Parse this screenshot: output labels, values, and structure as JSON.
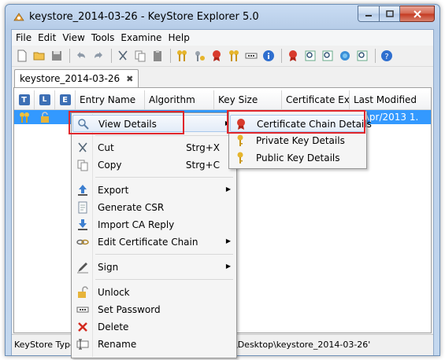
{
  "window": {
    "title": "keystore_2014-03-26 - KeyStore Explorer 5.0"
  },
  "menubar": [
    "File",
    "Edit",
    "View",
    "Tools",
    "Examine",
    "Help"
  ],
  "toolbar": {
    "icons": [
      "new-icon",
      "open-icon",
      "save-icon",
      "undo-icon",
      "redo-icon",
      "cut-icon",
      "copy-icon",
      "paste-icon",
      "generate-keypair-icon",
      "generate-secret-key-icon",
      "import-trusted-cert-icon",
      "import-keypair-icon",
      "set-password-icon",
      "properties-icon",
      "examine-file-icon",
      "examine-clipboard-icon",
      "examine-ssl-icon",
      "examine-csr-icon",
      "examine-crl-icon",
      "help-icon"
    ]
  },
  "tab": {
    "label": "keystore_2014-03-26",
    "close": "✖"
  },
  "table": {
    "icon_headers": [
      "T",
      "L",
      "E"
    ],
    "headers": [
      "Entry Name",
      "Algorithm",
      "Key Size",
      "Certificate Ex...",
      "Last Modified"
    ],
    "row": {
      "last_modified": "5/Apr/2013 1..."
    }
  },
  "status": {
    "left": "KeyStore Type",
    "right": "\\Desktop\\keystore_2014-03-26'"
  },
  "context_menu": {
    "view_details": "View Details",
    "cut": "Cut",
    "cut_shortcut": "Strg+X",
    "copy": "Copy",
    "copy_shortcut": "Strg+C",
    "export": "Export",
    "generate_csr": "Generate CSR",
    "import_ca_reply": "Import CA Reply",
    "edit_cert_chain": "Edit Certificate Chain",
    "sign": "Sign",
    "unlock": "Unlock",
    "set_password": "Set Password",
    "delete": "Delete",
    "rename": "Rename"
  },
  "submenu": {
    "cert_chain_details": "Certificate Chain Details",
    "private_key_details": "Private Key Details",
    "public_key_details": "Public Key Details"
  },
  "colors": {
    "selection": "#3399ff",
    "highlight_box": "#e0262c",
    "title_gradient": "#c9dcf3"
  }
}
